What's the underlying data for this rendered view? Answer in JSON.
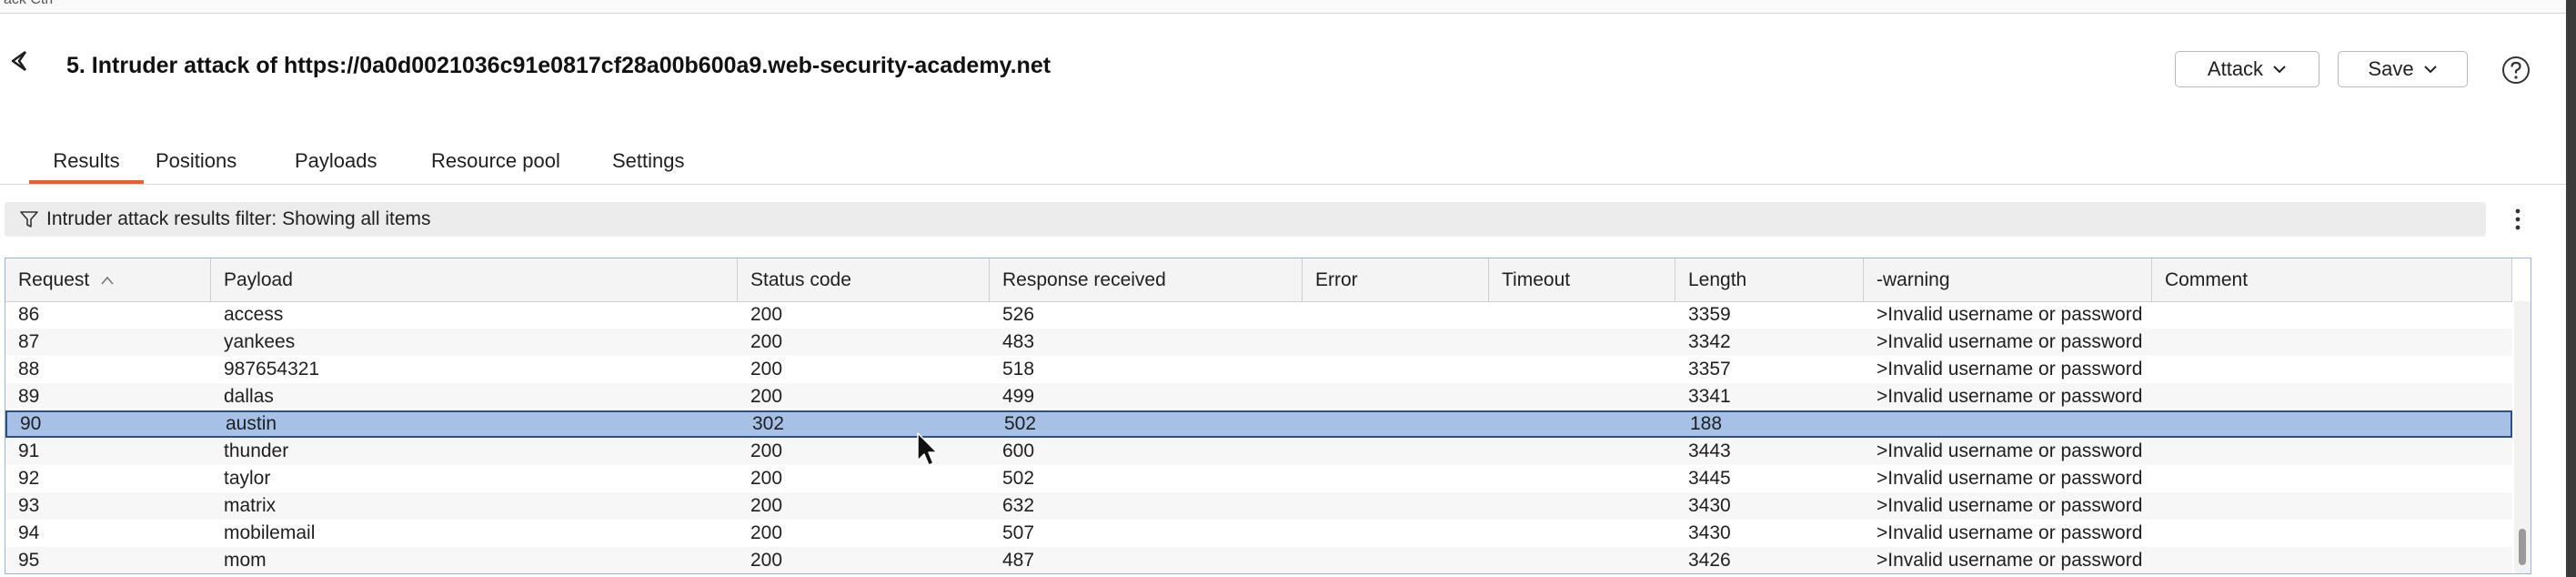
{
  "top_sliver": {
    "text": "ack    Ctrl"
  },
  "header": {
    "title": "5. Intruder attack of https://0a0d0021036c91e0817cf28a00b600a9.web-security-academy.net",
    "attack_label": "Attack",
    "save_label": "Save"
  },
  "tabs": [
    {
      "label": "Results",
      "active": true
    },
    {
      "label": "Positions"
    },
    {
      "label": "Payloads"
    },
    {
      "label": "Resource pool"
    },
    {
      "label": "Settings"
    }
  ],
  "filter": {
    "text": "Intruder attack results filter: Showing all items"
  },
  "table": {
    "columns": [
      "Request",
      "Payload",
      "Status code",
      "Response received",
      "Error",
      "Timeout",
      "Length",
      "-warning",
      "Comment"
    ],
    "sort": {
      "column": "Request",
      "direction": "ascending"
    },
    "selected_request": "90",
    "rows": [
      {
        "request": "86",
        "payload": "access",
        "status": "200",
        "received": "526",
        "error": "",
        "timeout": "",
        "length": "3359",
        "warning": ">Invalid username or password",
        "comment": ""
      },
      {
        "request": "87",
        "payload": "yankees",
        "status": "200",
        "received": "483",
        "error": "",
        "timeout": "",
        "length": "3342",
        "warning": ">Invalid username or password",
        "comment": ""
      },
      {
        "request": "88",
        "payload": "987654321",
        "status": "200",
        "received": "518",
        "error": "",
        "timeout": "",
        "length": "3357",
        "warning": ">Invalid username or password",
        "comment": ""
      },
      {
        "request": "89",
        "payload": "dallas",
        "status": "200",
        "received": "499",
        "error": "",
        "timeout": "",
        "length": "3341",
        "warning": ">Invalid username or password",
        "comment": ""
      },
      {
        "request": "90",
        "payload": "austin",
        "status": "302",
        "received": "502",
        "error": "",
        "timeout": "",
        "length": "188",
        "warning": "",
        "comment": ""
      },
      {
        "request": "91",
        "payload": "thunder",
        "status": "200",
        "received": "600",
        "error": "",
        "timeout": "",
        "length": "3443",
        "warning": ">Invalid username or password",
        "comment": ""
      },
      {
        "request": "92",
        "payload": "taylor",
        "status": "200",
        "received": "502",
        "error": "",
        "timeout": "",
        "length": "3445",
        "warning": ">Invalid username or password",
        "comment": ""
      },
      {
        "request": "93",
        "payload": "matrix",
        "status": "200",
        "received": "632",
        "error": "",
        "timeout": "",
        "length": "3430",
        "warning": ">Invalid username or password",
        "comment": ""
      },
      {
        "request": "94",
        "payload": "mobilemail",
        "status": "200",
        "received": "507",
        "error": "",
        "timeout": "",
        "length": "3430",
        "warning": ">Invalid username or password",
        "comment": ""
      },
      {
        "request": "95",
        "payload": "mom",
        "status": "200",
        "received": "487",
        "error": "",
        "timeout": "",
        "length": "3426",
        "warning": ">Invalid username or password",
        "comment": ""
      }
    ]
  },
  "icons": {
    "back": "burp-back-icon",
    "help": "help-circle-icon",
    "filter": "filter-funnel-icon",
    "more": "kebab-menu-icon"
  },
  "colors": {
    "accent": "#e8602c",
    "selection": "#a6c0e6",
    "selection_border": "#2b4f86"
  }
}
